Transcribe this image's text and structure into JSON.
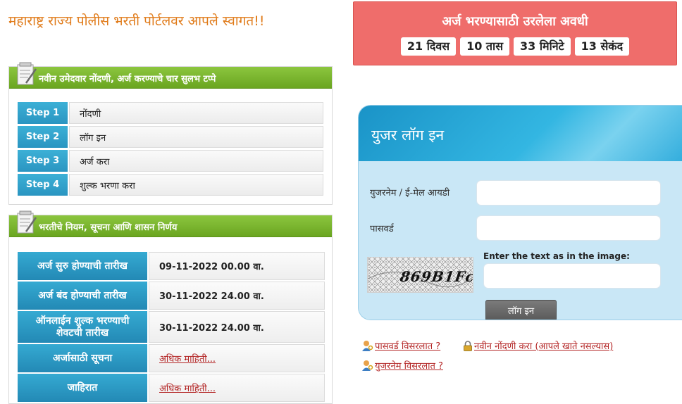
{
  "header": {
    "welcome": "महाराष्ट्र राज्य पोलीस भरती पोर्टलवर आपले स्वागत!!"
  },
  "countdown": {
    "title": "अर्ज भरण्यासाठी उरलेला अवधी",
    "days": "21 दिवस",
    "hours": "10 तास",
    "minutes": "33 मिनिटे",
    "seconds": "13 सेकंद"
  },
  "steps_panel": {
    "title": "नवीन उमेदवार नोंदणी, अर्ज करण्याचे चार सुलभ टप्पे",
    "steps": [
      {
        "label": "Step 1",
        "text": "नोंदणी"
      },
      {
        "label": "Step 2",
        "text": "लॉग इन"
      },
      {
        "label": "Step 3",
        "text": "अर्ज करा"
      },
      {
        "label": "Step 4",
        "text": "शुल्क भरणा करा"
      }
    ]
  },
  "rules_panel": {
    "title": "भरतीचे नियम, सूचना आणि शासन निर्णय",
    "rows": [
      {
        "label": "अर्ज सुरु होण्याची तारीख",
        "value": "09-11-2022 00.00 वा."
      },
      {
        "label": "अर्ज बंद होण्याची तारीख",
        "value": "30-11-2022 24.00 वा."
      },
      {
        "label": "ऑनलाईन शुल्क भरण्याची शेवटची तारीख",
        "value": "30-11-2022 24.00 वा."
      },
      {
        "label": "अर्जासाठी सूचना",
        "link": "अधिक माहिती..."
      },
      {
        "label": "जाहिरात",
        "link": "अधिक माहिती..."
      }
    ]
  },
  "login": {
    "title": "युजर लॉग इन",
    "username_label": "युजरनेम / ई-मेल आयडी",
    "username_value": "",
    "password_label": "पासवर्ड",
    "password_value": "",
    "captcha_label": "Enter the text as in the image:",
    "captcha_text": "869B1Fc",
    "captcha_value": "",
    "button": "लॉग इन"
  },
  "links": {
    "forgot_password": "पासवर्ड विसरलात ?",
    "new_registration": "नवीन नोंदणी करा (आपले खाते नसल्यास)",
    "forgot_username": "युजरनेम विसरलात ?"
  },
  "colors": {
    "accent_green": "#7ab52e",
    "step_blue": "#2a95c1",
    "countdown_red": "#ef6d6b",
    "link_red": "#b32424",
    "welcome_orange": "#e07b1a"
  }
}
